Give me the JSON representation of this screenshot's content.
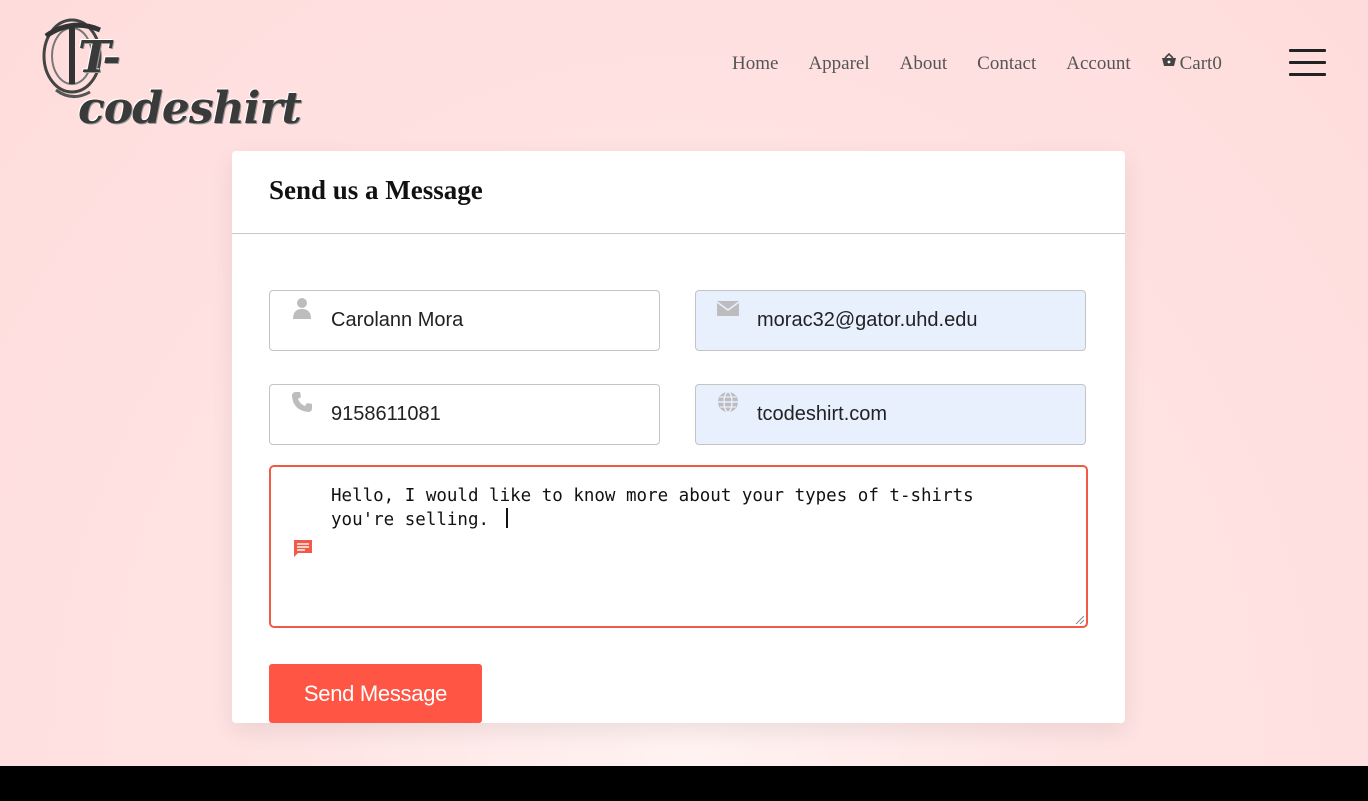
{
  "header": {
    "logo_text": "T-codeshirt",
    "nav": {
      "home": "Home",
      "apparel": "Apparel",
      "about": "About",
      "contact": "Contact",
      "account": "Account",
      "cart": "Cart0"
    }
  },
  "form": {
    "title": "Send us a Message",
    "name_value": "Carolann Mora",
    "email_value": "morac32@gator.uhd.edu",
    "phone_value": "9158611081",
    "website_value": "tcodeshirt.com",
    "message_value": "Hello, I would like to know more about your types of t-shirts\nyou're selling. ",
    "submit_label": "Send Message"
  },
  "colors": {
    "accent": "#fe5544",
    "focus_border": "#f05a46",
    "autofill_bg": "#e8f0fe",
    "icon_gray": "#bdbdbd"
  },
  "icons": {
    "name": "user-icon",
    "email": "envelope-icon",
    "phone": "phone-icon",
    "website": "globe-icon",
    "message": "message-icon",
    "cart": "basket-icon",
    "menu": "hamburger-icon"
  }
}
